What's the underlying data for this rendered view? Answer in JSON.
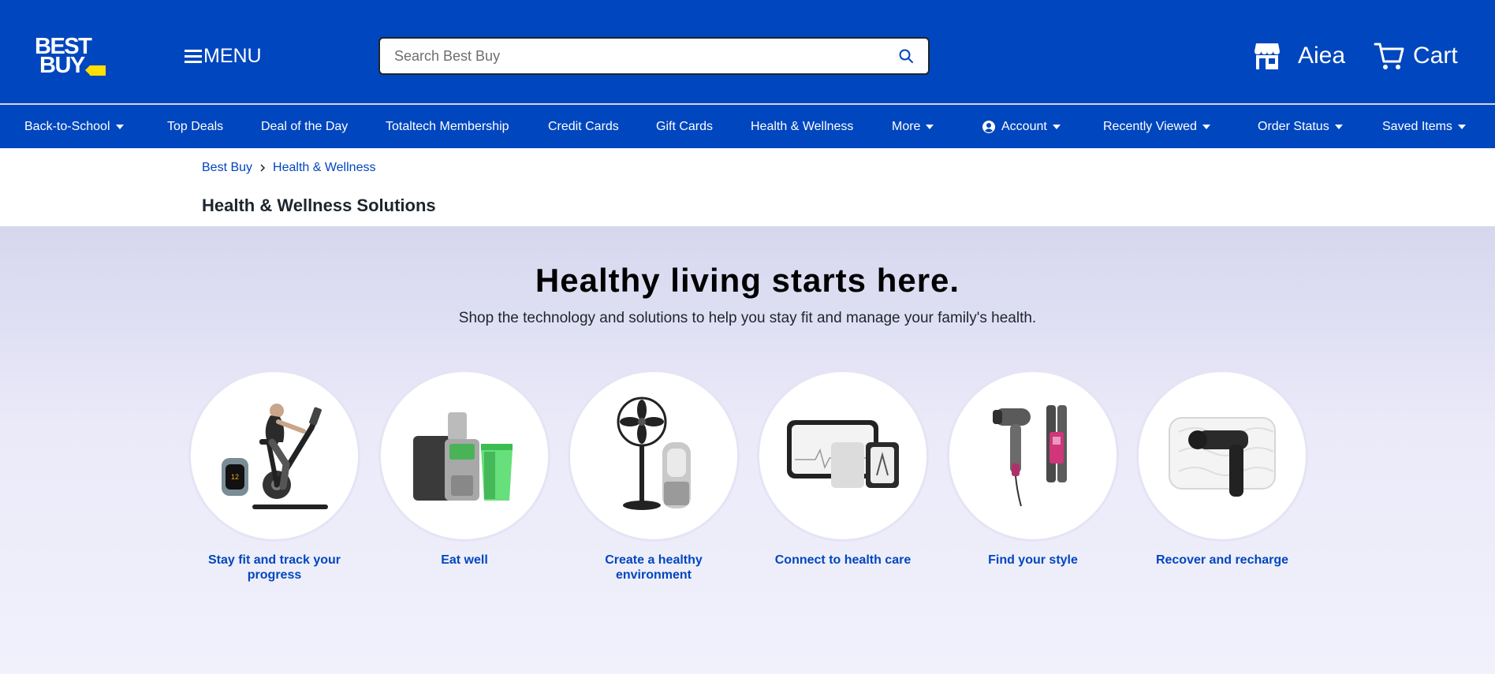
{
  "brand": {
    "logo_line1": "BEST",
    "logo_line2": "BUY",
    "tag_color": "#ffe000",
    "primary_color": "#0046be"
  },
  "header": {
    "menu_label": "MENU",
    "search_placeholder": "Search Best Buy",
    "store_label": "Aiea",
    "cart_label": "Cart"
  },
  "nav": {
    "items": [
      {
        "label": "Back-to-School",
        "icon": "caret-down-icon"
      },
      {
        "label": "Top Deals"
      },
      {
        "label": "Deal of the Day"
      },
      {
        "label": "Totaltech Membership"
      },
      {
        "label": "Credit Cards"
      },
      {
        "label": "Gift Cards"
      },
      {
        "label": "Health & Wellness"
      },
      {
        "label": "More",
        "icon": "caret-down-icon"
      },
      {
        "label": "Account",
        "icon": "account-icon"
      },
      {
        "label": "Recently Viewed",
        "icon": "caret-down-icon"
      },
      {
        "label": "Order Status",
        "icon": "caret-down-icon"
      },
      {
        "label": "Saved Items",
        "icon": "caret-down-icon"
      }
    ]
  },
  "breadcrumb": {
    "home": "Best Buy",
    "current": "Health & Wellness"
  },
  "page_title": "Health & Wellness Solutions",
  "hero": {
    "heading": "Healthy living starts here.",
    "subheading": "Shop the technology and solutions to help you stay fit and manage your family's health.",
    "categories": [
      {
        "label": "Stay fit and track your progress",
        "image": "exercise-bike-and-fitness-tracker"
      },
      {
        "label": "Eat well",
        "image": "juicer"
      },
      {
        "label": "Create a healthy environment",
        "image": "fan-and-air-purifier"
      },
      {
        "label": "Connect to health care",
        "image": "phone-and-ekg-monitor"
      },
      {
        "label": "Find your style",
        "image": "hair-dryer-and-straightener"
      },
      {
        "label": "Recover and recharge",
        "image": "pillow-and-massage-gun"
      }
    ]
  }
}
